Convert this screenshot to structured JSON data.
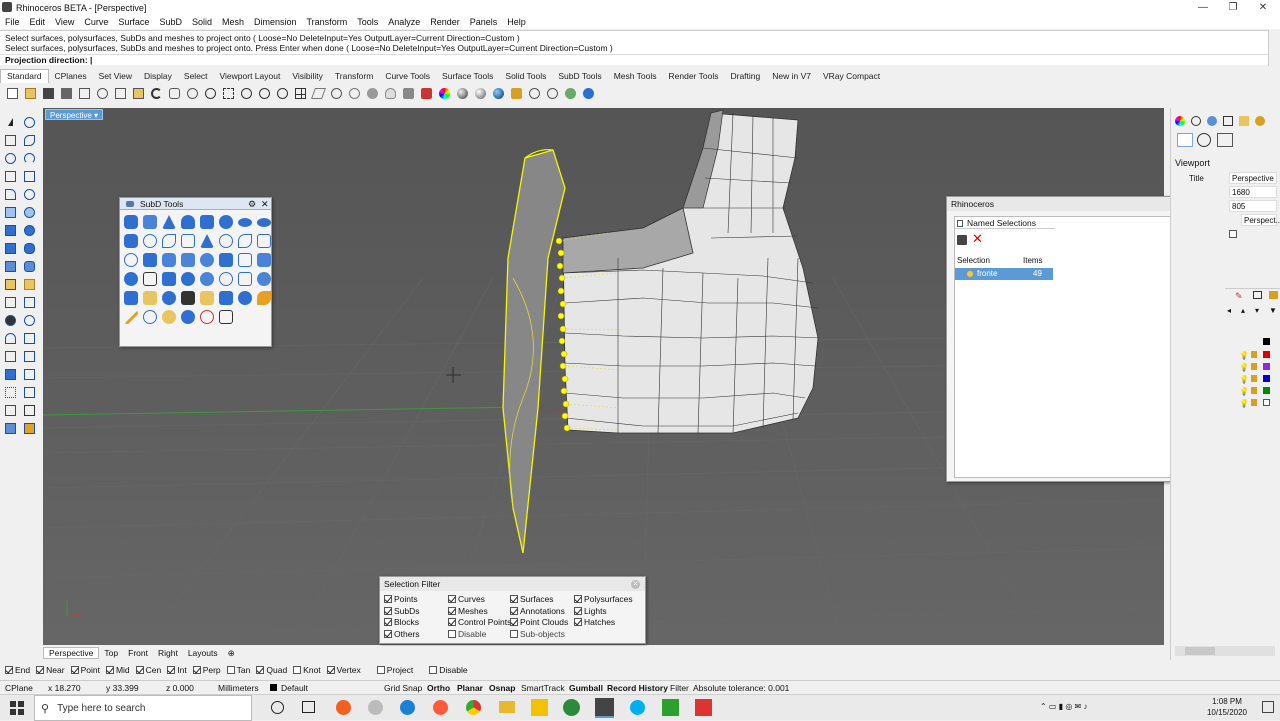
{
  "window": {
    "title": "Rhinoceros BETA - [Perspective]"
  },
  "menu": [
    "File",
    "Edit",
    "View",
    "Curve",
    "Surface",
    "SubD",
    "Solid",
    "Mesh",
    "Dimension",
    "Transform",
    "Tools",
    "Analyze",
    "Render",
    "Panels",
    "Help"
  ],
  "command": {
    "history": [
      "Select surfaces, polysurfaces, SubDs and meshes to project onto ( Loose=No  DeleteInput=Yes  OutputLayer=Current  Direction=Custom )",
      "Select surfaces, polysurfaces, SubDs and meshes to project onto. Press Enter when done ( Loose=No  DeleteInput=Yes  OutputLayer=Current  Direction=Custom )"
    ],
    "prompt": "Projection direction:"
  },
  "tabs": [
    "Standard",
    "CPlanes",
    "Set View",
    "Display",
    "Select",
    "Viewport Layout",
    "Visibility",
    "Transform",
    "Curve Tools",
    "Surface Tools",
    "Solid Tools",
    "SubD Tools",
    "Mesh Tools",
    "Render Tools",
    "Drafting",
    "New in V7",
    "VRay Compact"
  ],
  "viewport": {
    "label": "Perspective",
    "bottom_tabs": [
      "Perspective",
      "Top",
      "Front",
      "Right",
      "Layouts"
    ]
  },
  "subd_tools": {
    "title": "SubD Tools"
  },
  "rhino_panel": {
    "title": "Rhinoceros",
    "tab": "Named Selections",
    "columns": [
      "Selection",
      "Items"
    ],
    "rows": [
      {
        "name": "fronte",
        "items": "49"
      }
    ]
  },
  "selection_filter": {
    "title": "Selection Filter",
    "items": [
      {
        "label": "Points",
        "checked": true
      },
      {
        "label": "Curves",
        "checked": true
      },
      {
        "label": "Surfaces",
        "checked": true
      },
      {
        "label": "Polysurfaces",
        "checked": true
      },
      {
        "label": "SubDs",
        "checked": true
      },
      {
        "label": "Meshes",
        "checked": true
      },
      {
        "label": "Annotations",
        "checked": true
      },
      {
        "label": "Lights",
        "checked": true
      },
      {
        "label": "Blocks",
        "checked": true
      },
      {
        "label": "Control Points",
        "checked": true
      },
      {
        "label": "Point Clouds",
        "checked": true
      },
      {
        "label": "Hatches",
        "checked": true
      },
      {
        "label": "Others",
        "checked": true
      },
      {
        "label": "Disable",
        "checked": false
      },
      {
        "label": "Sub-objects",
        "checked": false
      }
    ]
  },
  "right_panel": {
    "heading": "Viewport",
    "props": [
      {
        "label": "Title",
        "value": "Perspective"
      },
      {
        "label": "",
        "value": "1680"
      },
      {
        "label": "",
        "value": "805"
      },
      {
        "label": "",
        "value": "Perspect..."
      }
    ]
  },
  "osnaps": [
    {
      "label": "End",
      "checked": true
    },
    {
      "label": "Near",
      "checked": true
    },
    {
      "label": "Point",
      "checked": true
    },
    {
      "label": "Mid",
      "checked": true
    },
    {
      "label": "Cen",
      "checked": true
    },
    {
      "label": "Int",
      "checked": true
    },
    {
      "label": "Perp",
      "checked": true
    },
    {
      "label": "Tan",
      "checked": false
    },
    {
      "label": "Quad",
      "checked": true
    },
    {
      "label": "Knot",
      "checked": false
    },
    {
      "label": "Vertex",
      "checked": true
    },
    {
      "label": "Project",
      "checked": false
    },
    {
      "label": "Disable",
      "checked": false
    }
  ],
  "status": {
    "cplane": "CPlane",
    "x": "x 18.270",
    "y": "y 33.399",
    "z": "z 0.000",
    "units": "Millimeters",
    "layer": "Default",
    "toggles": [
      "Grid Snap",
      "Ortho",
      "Planar",
      "Osnap",
      "SmartTrack",
      "Gumball",
      "Record History",
      "Filter"
    ],
    "tolerance": "Absolute tolerance: 0.001"
  },
  "taskbar": {
    "search_placeholder": "Type here to search",
    "time": "1:08 PM",
    "date": "10/15/2020"
  },
  "colors": {
    "accent": "#5b9bd5",
    "selection": "#ffff00",
    "viewport_bg": "#5d5d5d"
  }
}
